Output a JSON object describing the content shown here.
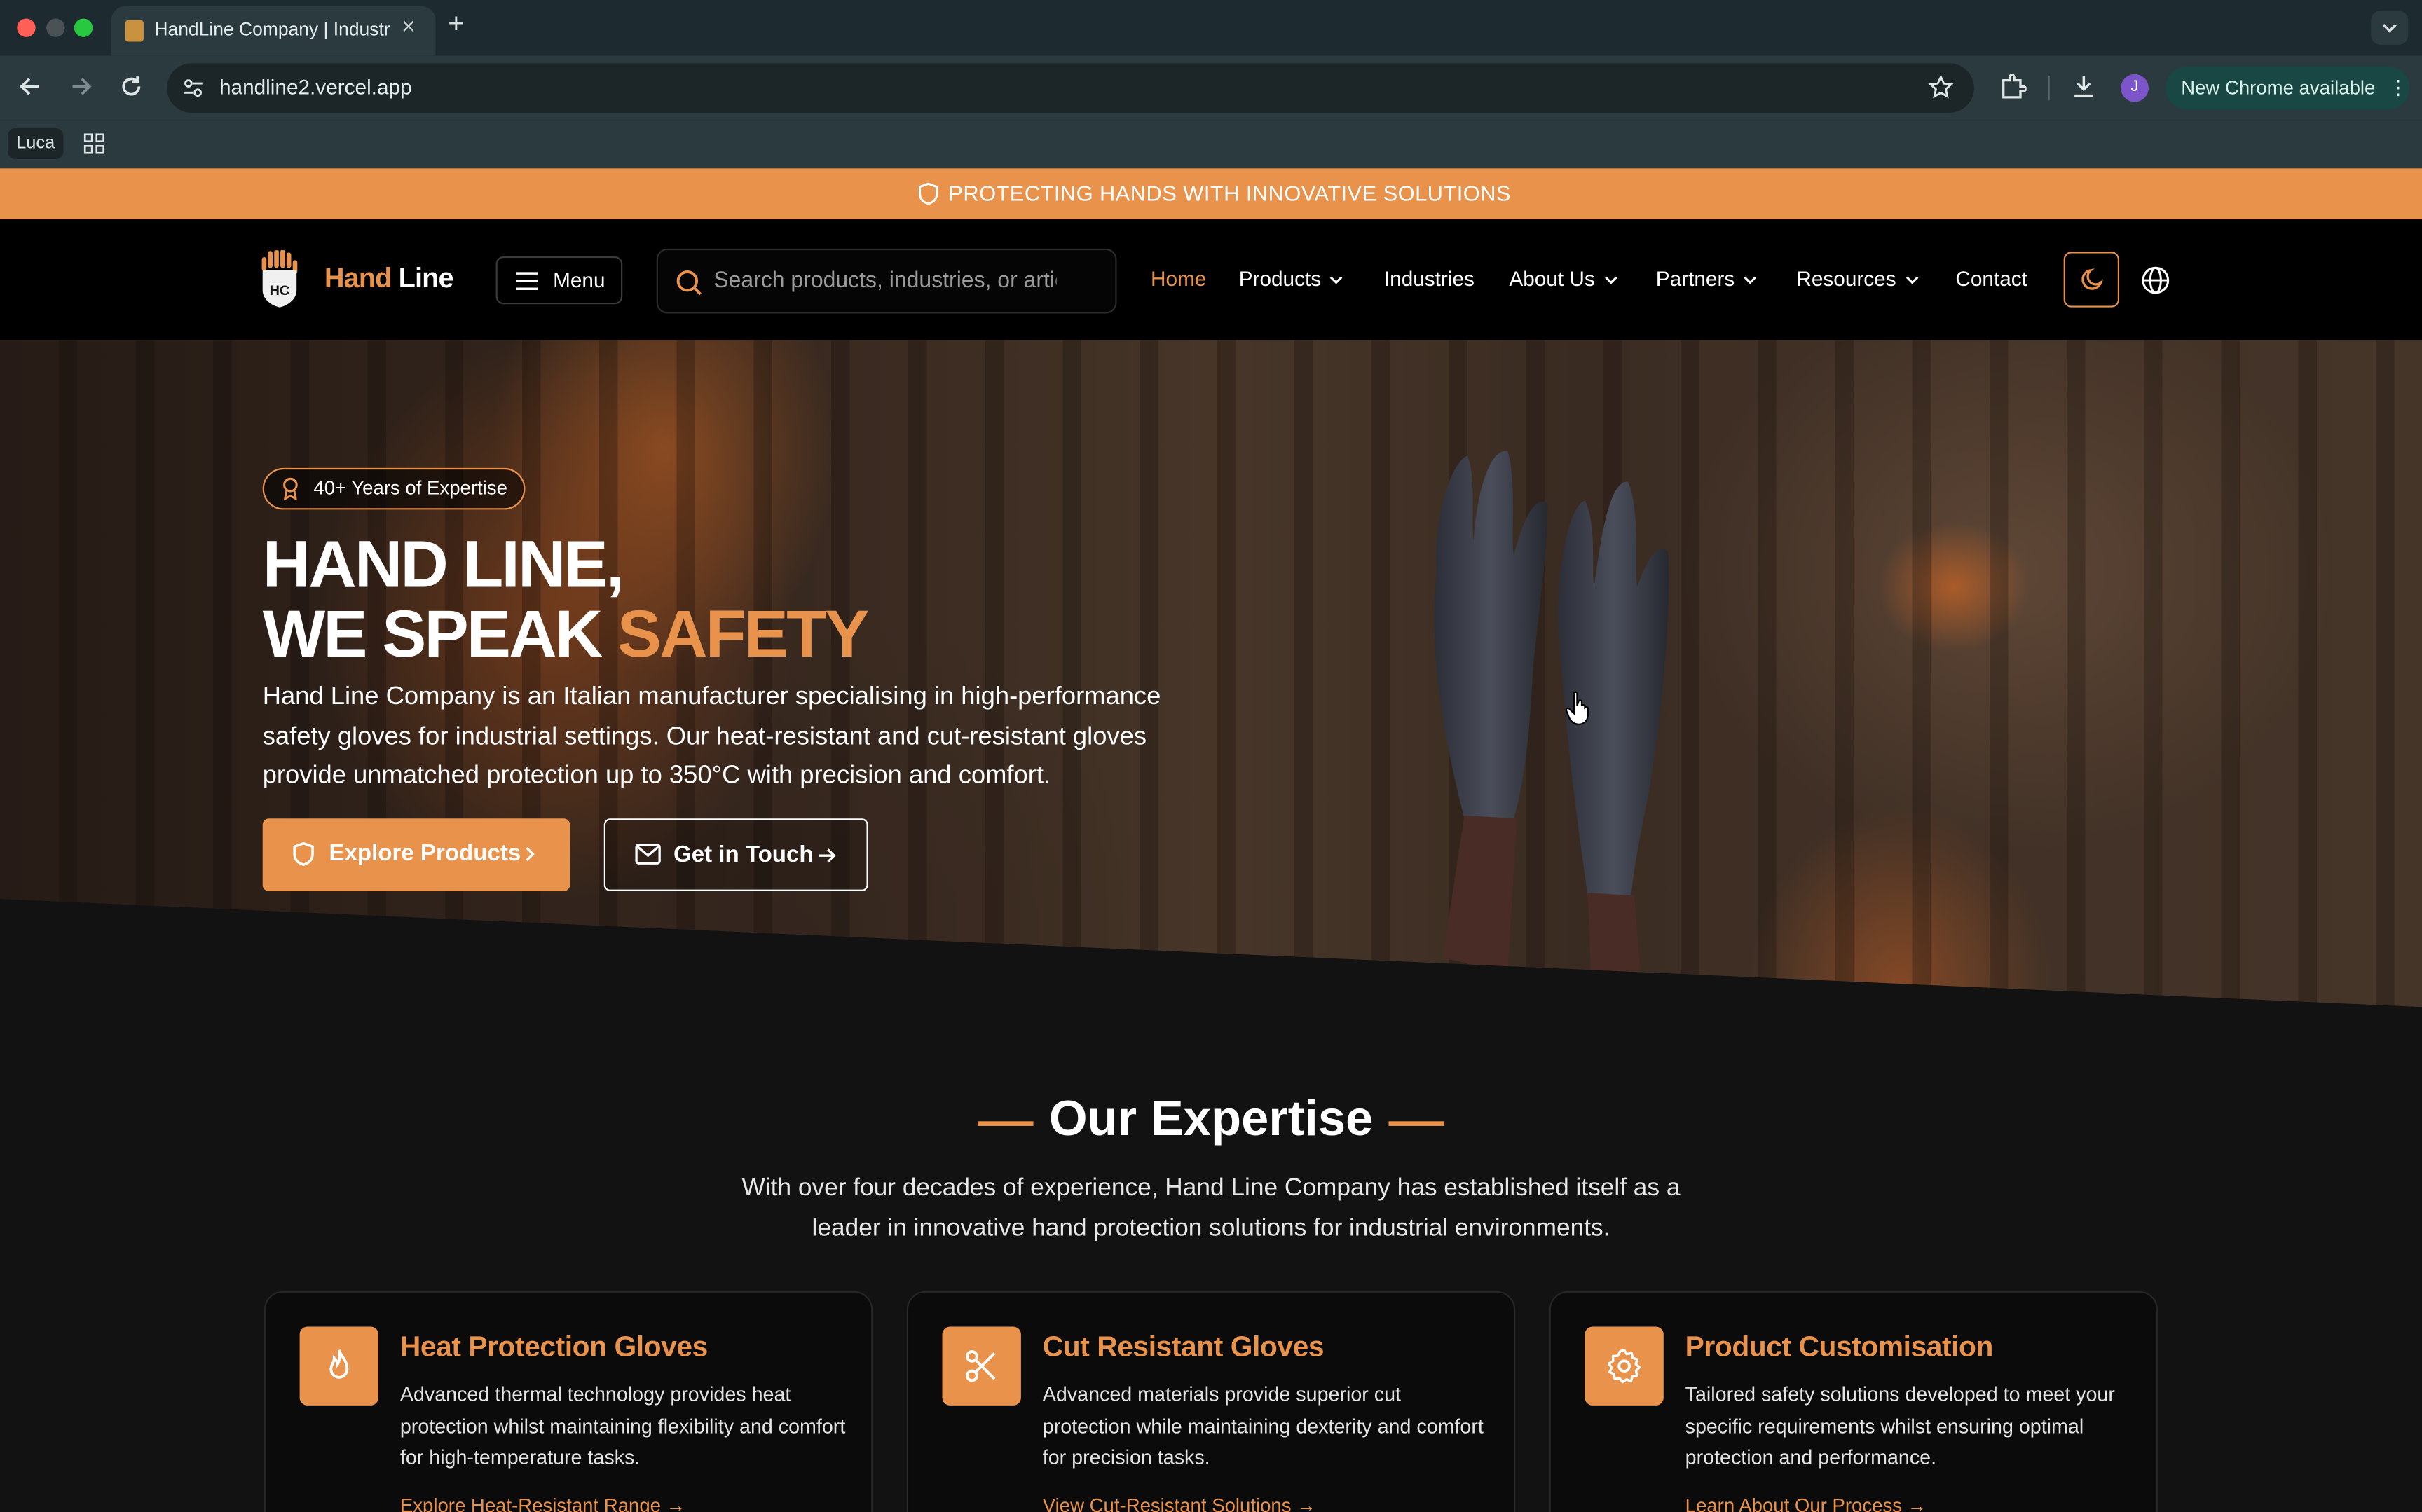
{
  "browser": {
    "tab_title": "HandLine Company | Industrial Safety Gloves",
    "tab_close": "×",
    "new_tab": "+",
    "url": "handline2.vercel.app",
    "avatar_letter": "J",
    "update_label": "New Chrome available",
    "update_menu": "⋮",
    "bookmark_label": "Luca"
  },
  "promo": {
    "text": "PROTECTING HANDS WITH INNOVATIVE SOLUTIONS"
  },
  "nav": {
    "logo_part1": "Hand",
    "logo_part2": " Line",
    "menu_label": "Menu",
    "search_placeholder": "Search products, industries, or articles...",
    "links": {
      "home": "Home",
      "products": "Products",
      "industries": "Industries",
      "about": "About Us",
      "partners": "Partners",
      "resources": "Resources",
      "contact": "Contact"
    }
  },
  "hero": {
    "badge": "40+ Years of Expertise",
    "title_line1": "HAND LINE,",
    "title_line2_a": "WE SPEAK ",
    "title_line2_b": "SAFETY",
    "description": "Hand Line Company is an Italian manufacturer specialising in high-performance safety gloves for industrial settings. Our heat-resistant and cut-resistant gloves provide unmatched protection up to 350°C with precision and comfort.",
    "primary_cta": "Explore Products",
    "secondary_cta": "Get in Touch"
  },
  "expertise": {
    "title": "Our Expertise",
    "description": "With over four decades of experience, Hand Line Company has established itself as a leader in innovative hand protection solutions for industrial environments.",
    "cards": [
      {
        "icon": "flame-icon",
        "title": "Heat Protection Gloves",
        "text": "Advanced thermal technology provides heat protection whilst maintaining flexibility and comfort for high-temperature tasks.",
        "link": "Explore Heat-Resistant Range →"
      },
      {
        "icon": "scissors-icon",
        "title": "Cut Resistant Gloves",
        "text": "Advanced materials provide superior cut protection while maintaining dexterity and comfort for precision tasks.",
        "link": "View Cut-Resistant Solutions →"
      },
      {
        "icon": "gear-icon",
        "title": "Product Customisation",
        "text": "Tailored safety solutions developed to meet your specific requirements whilst ensuring optimal protection and performance.",
        "link": "Learn About Our Process →"
      }
    ]
  },
  "colors": {
    "accent": "#e8924b",
    "background": "#121212",
    "nav": "#000000",
    "chrome": "#2b3a3f"
  }
}
